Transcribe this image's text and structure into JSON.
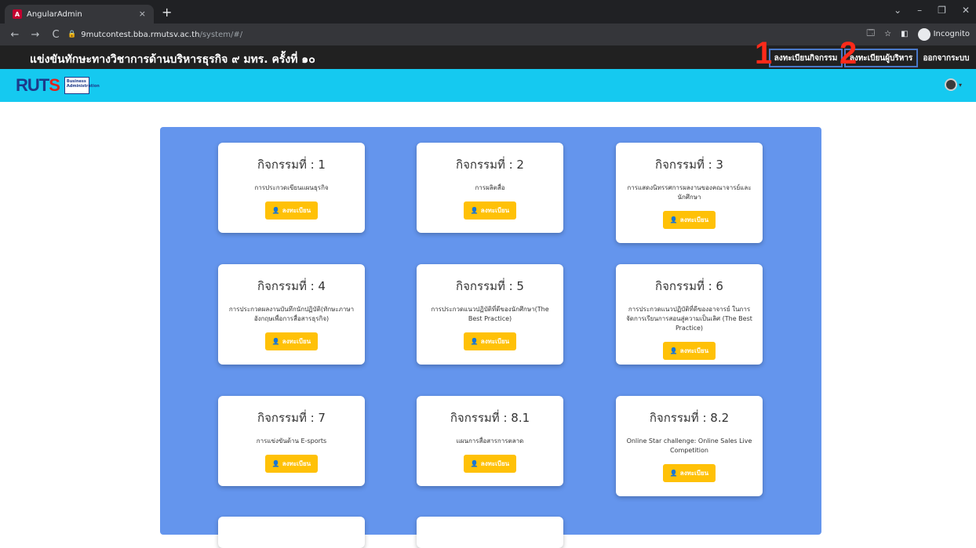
{
  "browser": {
    "tab_title": "AngularAdmin",
    "tab_favicon": "A",
    "close_glyph": "×",
    "new_tab_glyph": "+",
    "window_controls": [
      "⌄",
      "–",
      "❐",
      "✕"
    ],
    "nav": {
      "back": "←",
      "forward": "→",
      "reload": "C"
    },
    "url_host": "9mutcontest.bba.rmutsv.ac.th",
    "url_path": "/system/#/",
    "incognito_label": "Incognito",
    "toolbar_icons": [
      "🗔",
      "☆",
      "◧"
    ]
  },
  "header": {
    "title": "แข่งขันทักษะทางวิชาการด้านบริหารธุรกิจ ๙ มทร. ครั้งที่ ๑๐",
    "buttons": [
      {
        "label": "ลงทะเบียนกิจกรรม"
      },
      {
        "label": "ลงทะเบียนผู้บริหาร"
      },
      {
        "label": "ออกจากระบบ"
      }
    ],
    "annotations": [
      "1",
      "2"
    ]
  },
  "brand": {
    "logo_main": "RUT",
    "logo_accent": "S",
    "logo_badge": "Business Administration",
    "user_caret": "▾"
  },
  "activities": [
    {
      "title": "กิจกรรมที่ : 1",
      "desc": "การประกวดเขียนแผนธุรกิจ",
      "button": "ลงทะเบียน"
    },
    {
      "title": "กิจกรรมที่ : 2",
      "desc": "การผลิตสื่อ",
      "button": "ลงทะเบียน"
    },
    {
      "title": "กิจกรรมที่ : 3",
      "desc": "การแสดงนิทรรศการผลงานของคณาจารย์และนักศึกษา",
      "button": "ลงทะเบียน"
    },
    {
      "title": "กิจกรรมที่ : 4",
      "desc": "การประกวดผลงานบันทึกนักปฏิบัติ(ทักษะภาษาอังกฤษเพื่อการสื่อสารธุรกิจ)",
      "button": "ลงทะเบียน"
    },
    {
      "title": "กิจกรรมที่ : 5",
      "desc": "การประกวดแนวปฏิบัติที่ดีของนักศึกษา(The Best Practice)",
      "button": "ลงทะเบียน"
    },
    {
      "title": "กิจกรรมที่ : 6",
      "desc": "การประกวดแนวปฏิบัติที่ดีของอาจารย์ ในการจัดการเรียนการสอนสู่ความเป็นเลิศ (The Best Practice)",
      "button": "ลงทะเบียน"
    },
    {
      "title": "กิจกรรมที่ : 7",
      "desc": "การแข่งขันด้าน E-sports",
      "button": "ลงทะเบียน"
    },
    {
      "title": "กิจกรรมที่ : 8.1",
      "desc": "แผนการสื่อสารการตลาด",
      "button": "ลงทะเบียน"
    },
    {
      "title": "กิจกรรมที่ : 8.2",
      "desc": "Online Star challenge: Online Sales Live Competition",
      "button": "ลงทะเบียน"
    }
  ],
  "register_icon": "person-add-icon",
  "colors": {
    "header_bg": "#212121",
    "brand_bar": "#15c9f0",
    "panel": "#6495ed",
    "button": "#ffc107",
    "annotation": "#ff2a1a",
    "highlight_box": "#4a78c8"
  }
}
